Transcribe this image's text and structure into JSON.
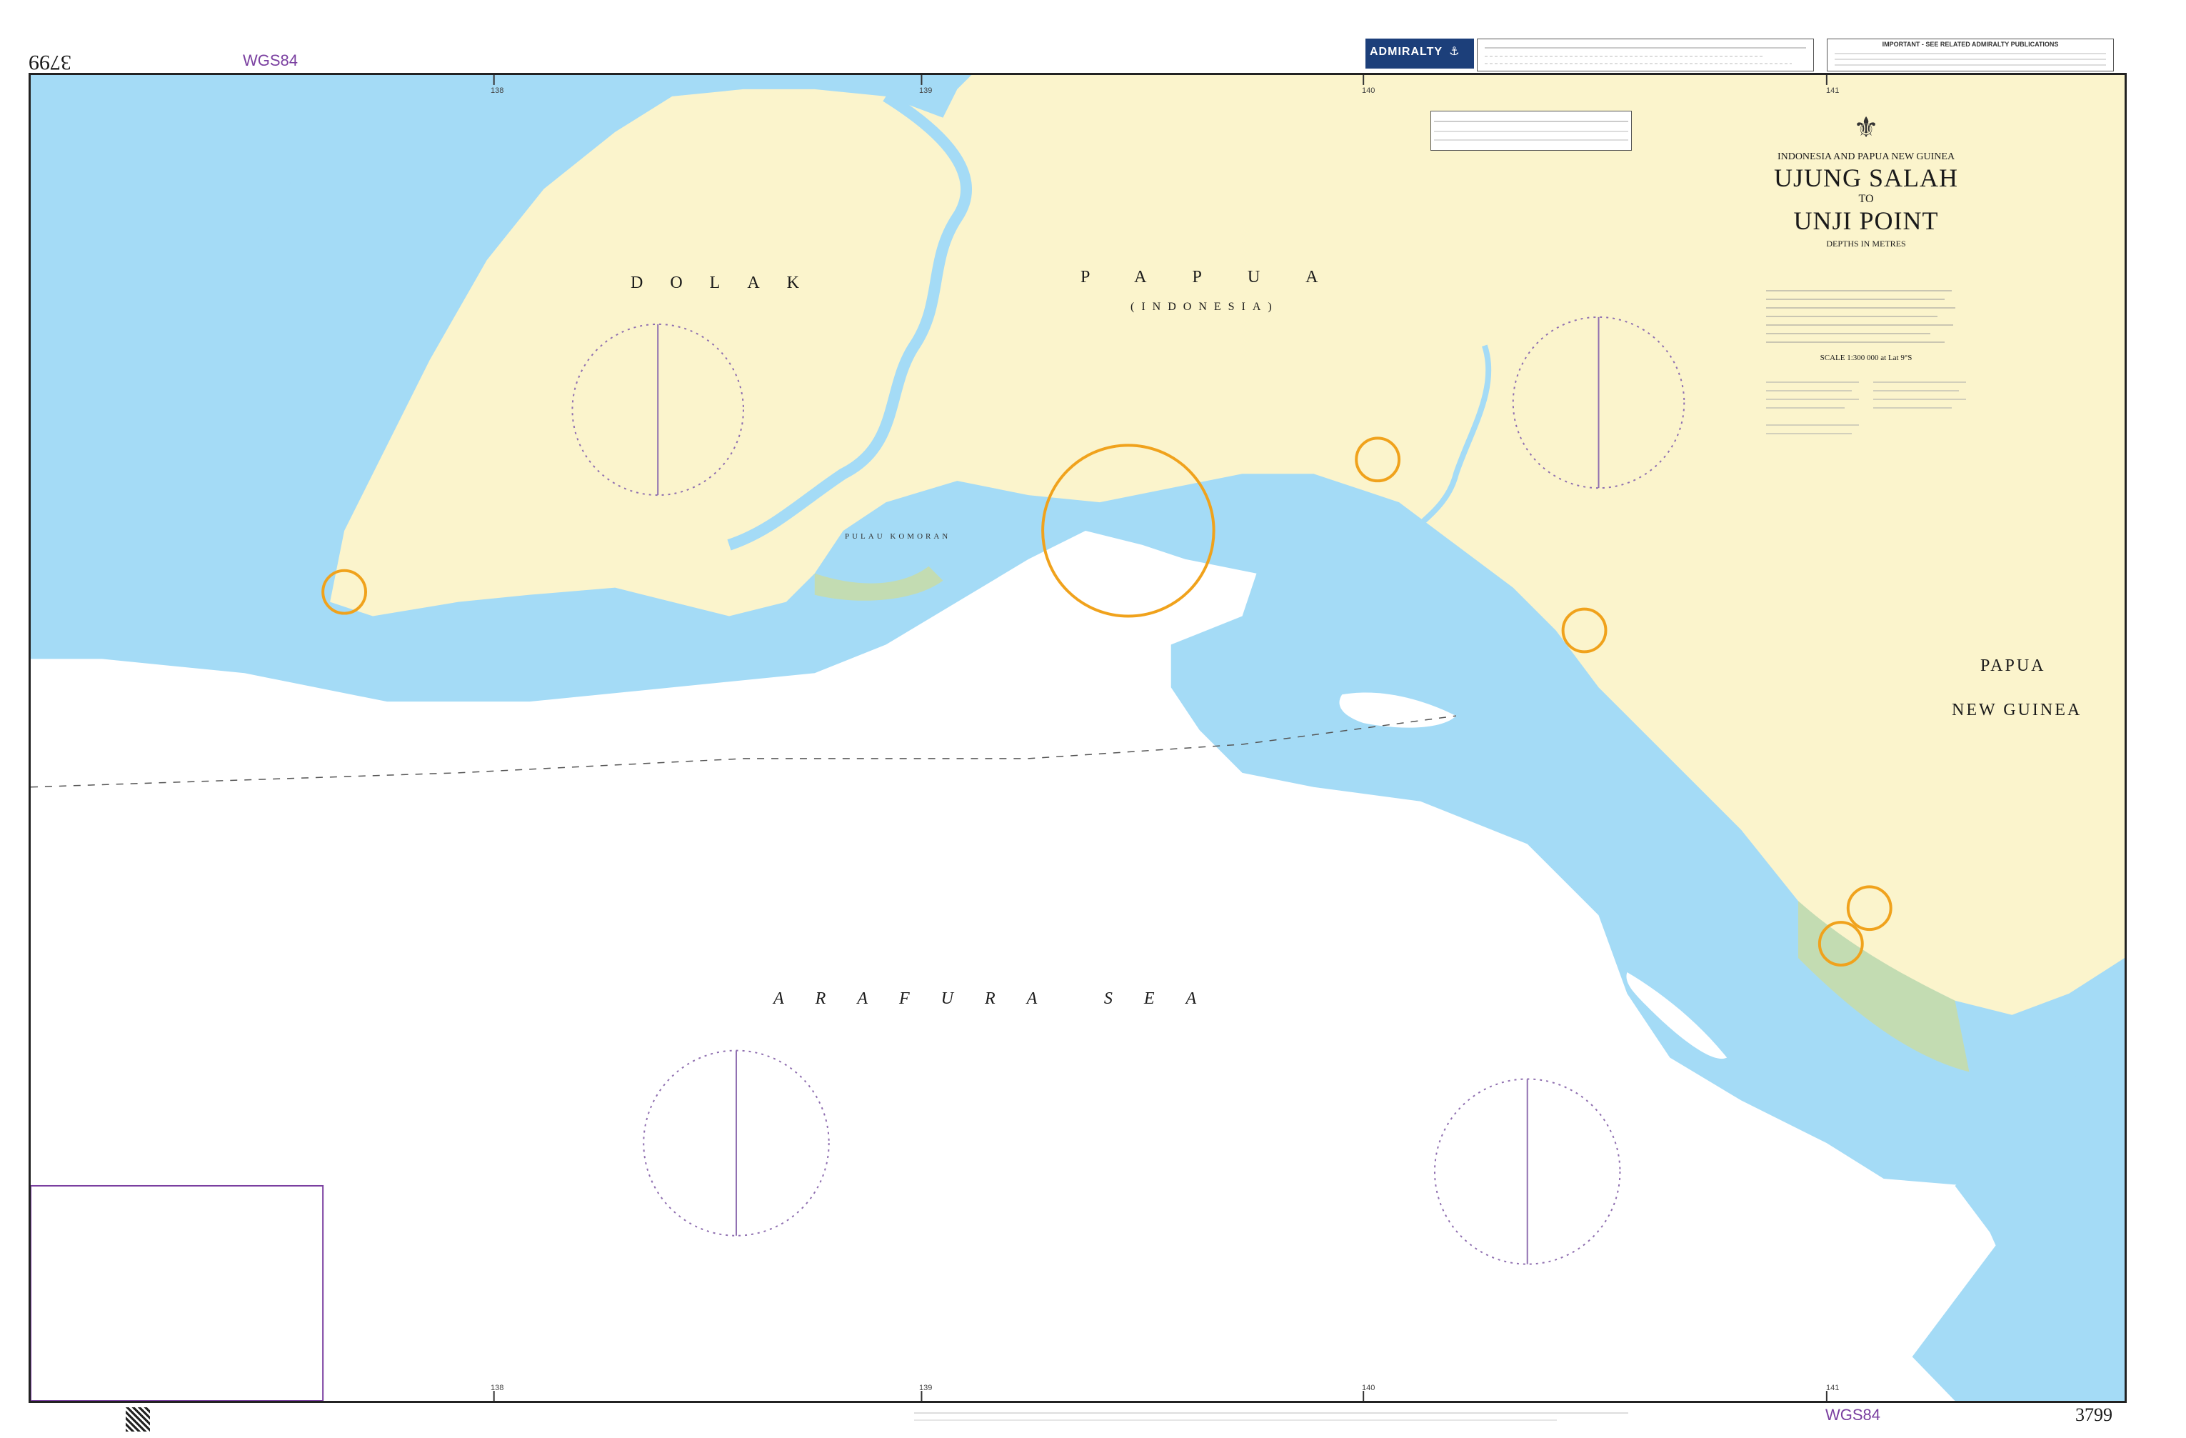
{
  "header": {
    "chart_number_inverted": "3799",
    "datum_top": "WGS84",
    "brand": "ADMIRALTY",
    "notice_title": "IMPORTANT - SEE RELATED ADMIRALTY PUBLICATIONS"
  },
  "footer": {
    "datum_bottom": "WGS84",
    "chart_number": "3799"
  },
  "chart": {
    "region_top": "INDONESIA AND PAPUA NEW GUINEA",
    "title_line1": "UJUNG SALAH",
    "title_to": "TO",
    "title_line2": "UNJI POINT",
    "depths": "DEPTHS IN METRES",
    "scale": "SCALE 1:300 000 at Lat 9°S"
  },
  "labels": {
    "dolak": "DOLAK",
    "papua": "PAPUA",
    "indonesia": "(INDONESIA)",
    "png_line1": "PAPUA",
    "png_line2": "NEW GUINEA",
    "arafura": "ARAFURA SEA",
    "pulau": "PULAU KOMORAN"
  },
  "graticule": {
    "top_ticks": [
      "138",
      "139",
      "140",
      "141"
    ],
    "bottom_ticks": [
      "138",
      "139",
      "140",
      "141"
    ]
  },
  "colors": {
    "land": "#fbf4cc",
    "water": "#a4dbf6",
    "intertidal": "#c3dcb2",
    "frame": "#222222",
    "purple": "#7a3fa0",
    "compass": "#8f6fb0",
    "orange": "#f0a21c"
  }
}
